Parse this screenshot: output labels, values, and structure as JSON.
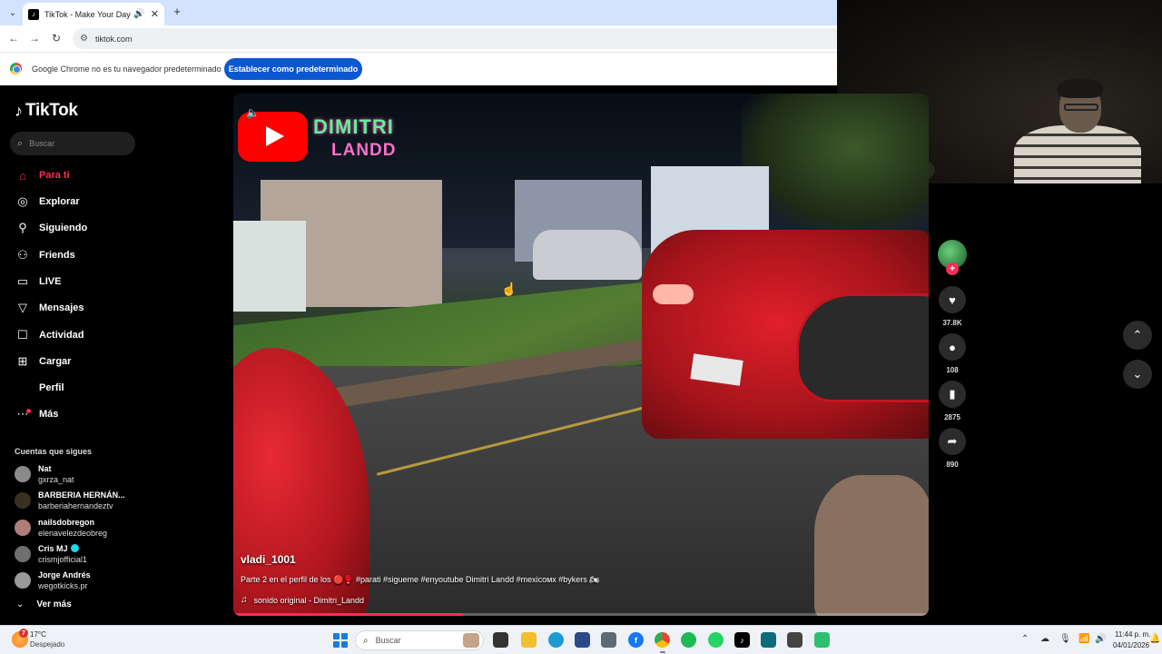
{
  "browser": {
    "tab_title": "TikTok - Make Your Day",
    "new_tab_icon": "+",
    "url": "tiktok.com",
    "infobar_text": "Google Chrome no es tu navegador predeterminado",
    "infobar_button": "Establecer como predeterminado"
  },
  "sidebar": {
    "logo_text": "TikTok",
    "search_placeholder": "Buscar",
    "nav": [
      {
        "label": "Para ti",
        "icon": "home-icon",
        "active": true
      },
      {
        "label": "Explorar",
        "icon": "compass-icon"
      },
      {
        "label": "Siguiendo",
        "icon": "following-icon"
      },
      {
        "label": "Friends",
        "icon": "friends-icon"
      },
      {
        "label": "LIVE",
        "icon": "live-icon"
      },
      {
        "label": "Mensajes",
        "icon": "messages-icon"
      },
      {
        "label": "Actividad",
        "icon": "activity-icon"
      },
      {
        "label": "Cargar",
        "icon": "upload-icon"
      },
      {
        "label": "Perfil",
        "icon": "profile-icon"
      },
      {
        "label": "Más",
        "icon": "more-icon"
      }
    ],
    "following_title": "Cuentas que sigues",
    "following": [
      {
        "name": "Nat",
        "username": "gxrza_nat"
      },
      {
        "name": "BARBERIA HERNÁN...",
        "username": "barberiahernandeztv"
      },
      {
        "name": "nailsdobregon",
        "username": "elenavelezdeobreg"
      },
      {
        "name": "Cris MJ",
        "username": "crismjofficial1",
        "verified": true
      },
      {
        "name": "Jorge Andrés",
        "username": "wegotkicks.pr"
      }
    ],
    "see_more": "Ver más"
  },
  "video": {
    "overlay_line1": "DIMITRI",
    "overlay_line2": "LANDD",
    "author": "vladi_1001",
    "caption": "Parte 2 en el perfil de los 🔴🥊 #parati #sigueme #enyoutube Dimitri Landd #mexicoмx #bykers 🏍",
    "sound": "sonido original - Dimitri_Landd",
    "progress": 0.33
  },
  "actions": {
    "likes": "37.8K",
    "comments": "108",
    "saves": "2875",
    "shares": "890"
  },
  "taskbar": {
    "weather_badge": "7",
    "weather_temp": "17°C",
    "weather_desc": "Despejado",
    "search_label": "Buscar",
    "time": "11:44 p. m.",
    "date": "04/01/2026"
  },
  "colors": {
    "accent": "#fe2c55",
    "chrome_blue": "#0b57d0"
  }
}
